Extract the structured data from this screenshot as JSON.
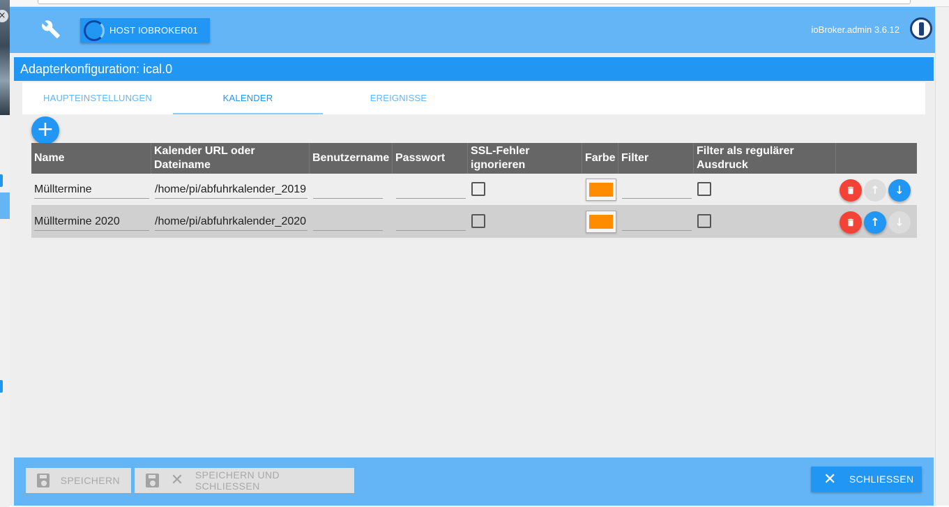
{
  "header": {
    "host_button_label": "HOST IOBROKER01",
    "version": "ioBroker.admin 3.6.12"
  },
  "page_title": "Adapterkonfiguration: ical.0",
  "tabs": [
    {
      "label": "HAUPTEINSTELLUNGEN",
      "active": false
    },
    {
      "label": "KALENDER",
      "active": true
    },
    {
      "label": "EREIGNISSE",
      "active": false
    }
  ],
  "add_button_label": "+",
  "table": {
    "columns": [
      "Name",
      "Kalender URL oder Dateiname",
      "Benutzername",
      "Passwort",
      "SSL-Fehler ignorieren",
      "Farbe",
      "Filter",
      "Filter als regulärer Ausdruck"
    ],
    "rows": [
      {
        "name": "Mülltermine",
        "url": "/home/pi/abfuhrkalender_2019",
        "user": "",
        "password": "",
        "ssl_ignore": false,
        "color": "#ff8c00",
        "filter": "",
        "filter_regex": false,
        "up_enabled": false,
        "down_enabled": true
      },
      {
        "name": "Mülltermine 2020",
        "url": "/home/pi/abfuhrkalender_2020",
        "user": "",
        "password": "",
        "ssl_ignore": false,
        "color": "#ff8c00",
        "filter": "",
        "filter_regex": false,
        "up_enabled": true,
        "down_enabled": false
      }
    ]
  },
  "footer": {
    "save_label": "SPEICHERN",
    "save_close_label": "SPEICHERN UND SCHLIESSEN",
    "close_label": "SCHLIESSEN"
  },
  "colors": {
    "primary": "#2196f3",
    "topbar": "#64b5f6",
    "delete": "#f44336",
    "swatch": "#ff8c00"
  }
}
